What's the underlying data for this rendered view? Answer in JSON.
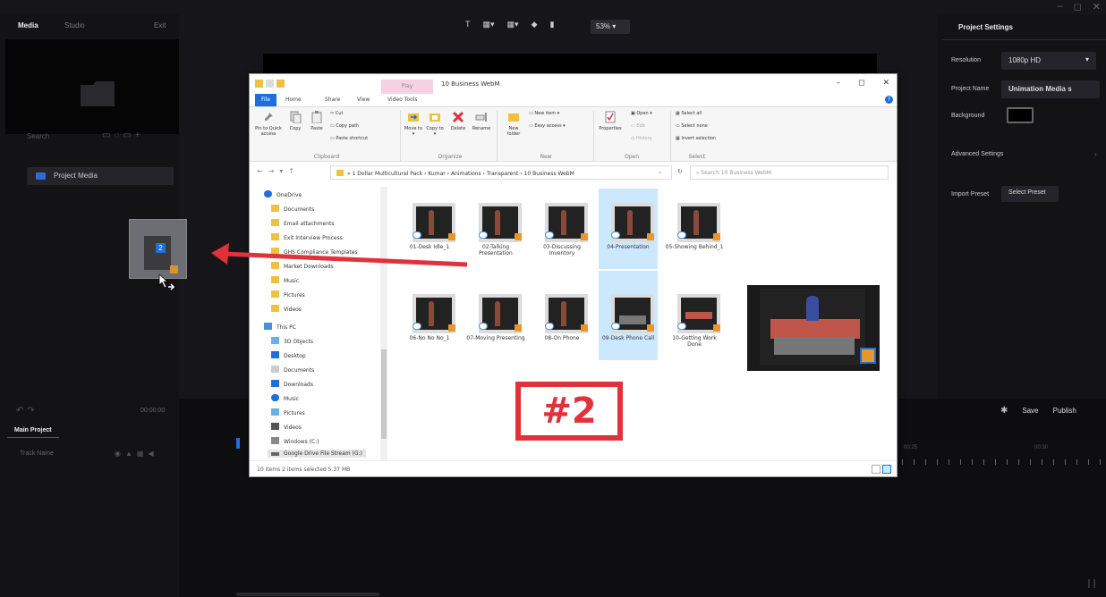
{
  "app": {
    "window_controls": [
      "–",
      "◻",
      "✕"
    ]
  },
  "left_panel": {
    "tabs": [
      "Media",
      "Studio",
      "Exit"
    ],
    "search_label": "Search",
    "project_media_label": "Project Media",
    "drag_badge": "2"
  },
  "canvas": {
    "tools": [
      "T",
      "▦▾",
      "▦▾",
      "◆",
      "▮"
    ],
    "zoom": "53%"
  },
  "right_panel": {
    "title": "Project Settings",
    "resolution_label": "Resolution",
    "resolution_value": "1080p HD",
    "project_name_label": "Project Name",
    "project_name_value": "Unimation Media s",
    "background_label": "Background",
    "advanced_label": "Advanced Settings",
    "import_preset_label": "Import Preset",
    "select_preset_button": "Select Preset"
  },
  "timeline": {
    "timecode": "00:00:00",
    "tab": "Main Project",
    "track_name": "Track Name",
    "save_label": "Save",
    "publish_label": "Publish",
    "ruler_labels": [
      "00:25",
      "00:30"
    ]
  },
  "explorer": {
    "play_tab": "Play",
    "title": "10 Business WebM",
    "tabs": [
      "File",
      "Home",
      "Share",
      "View",
      "Video Tools"
    ],
    "ribbon": {
      "clipboard": {
        "pin_label": "Pin to Quick access",
        "copy": "Copy",
        "paste": "Paste",
        "cut": "Cut",
        "copy_path": "Copy path",
        "paste_shortcut": "Paste shortcut",
        "group": "Clipboard"
      },
      "organize": {
        "move_to": "Move to ▾",
        "copy_to": "Copy to ▾",
        "delete": "Delete",
        "rename": "Rename",
        "group": "Organize"
      },
      "new": {
        "new_folder": "New folder",
        "new_item": "New item ▾",
        "easy_access": "Easy access ▾",
        "group": "New"
      },
      "open": {
        "properties": "Properties",
        "open": "Open ▾",
        "edit": "Edit",
        "history": "History",
        "group": "Open"
      },
      "select": {
        "select_all": "Select all",
        "select_none": "Select none",
        "invert_selection": "Invert selection",
        "group": "Select"
      }
    },
    "address": "1 Dollar Multicultural Pack  ›  Kumar  ›  Animations  ›  Transparent  ›  10 Business WebM",
    "search_placeholder": "Search 10 Business WebM",
    "nav": [
      "OneDrive",
      "Documents",
      "Email attachments",
      "Exit Interview Process",
      "GHS Compliance Templates",
      "Market Downloads",
      "Music",
      "Pictures",
      "Videos",
      "This PC",
      "3D Objects",
      "Desktop",
      "Documents",
      "Downloads",
      "Music",
      "Pictures",
      "Videos",
      "Windows (C:)",
      "Google Drive File Stream (G:)"
    ],
    "files": [
      {
        "name": "01-Desk Idle_1",
        "selected": false
      },
      {
        "name": "02-Talking Presentation",
        "selected": false
      },
      {
        "name": "03-Discussing Inventory",
        "selected": false
      },
      {
        "name": "04-Presentation",
        "selected": true
      },
      {
        "name": "05-Showing Behind_1",
        "selected": false
      },
      {
        "name": "06-No No No_1",
        "selected": false
      },
      {
        "name": "07-Moving Presenting",
        "selected": false
      },
      {
        "name": "08-On Phone",
        "selected": false
      },
      {
        "name": "09-Desk Phone Call",
        "selected": true
      },
      {
        "name": "10-Getting Work Done",
        "selected": false
      }
    ],
    "status": "10 items    2 items selected  5.37 MB"
  },
  "annotation": {
    "label": "#2",
    "color": "#e0323a"
  },
  "colors": {
    "accent": "#2b6cd8",
    "annotation": "#e0323a",
    "selection": "#cce8ff"
  }
}
